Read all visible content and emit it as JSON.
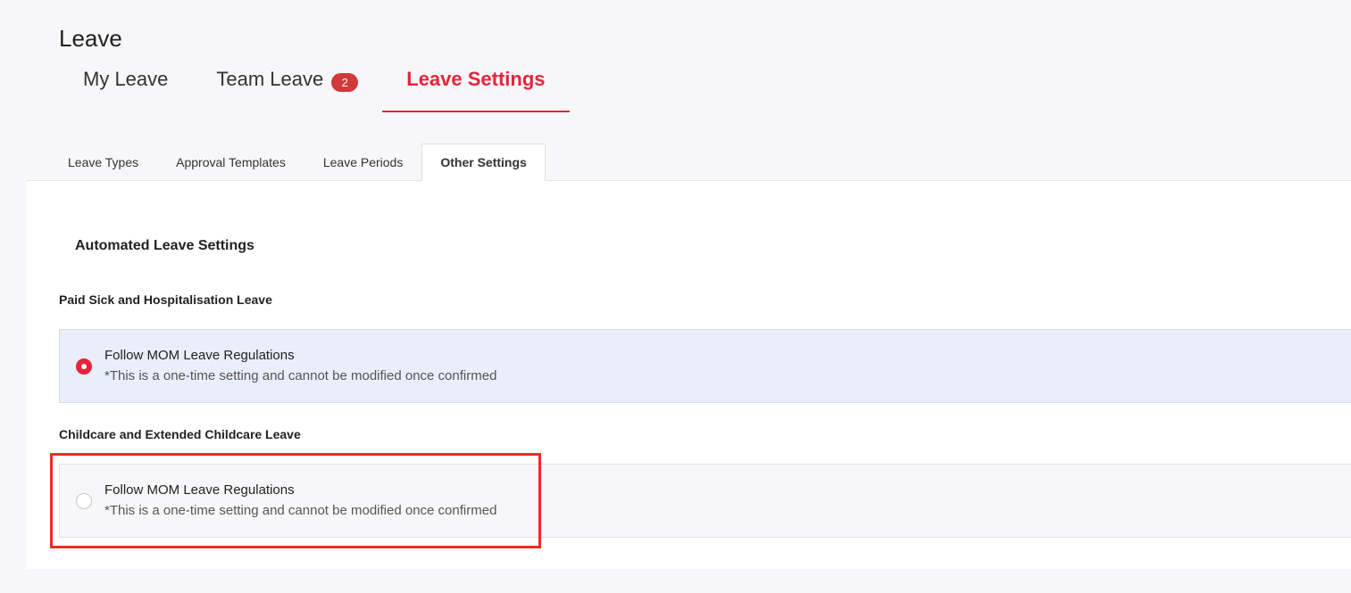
{
  "page": {
    "title": "Leave"
  },
  "main_tabs": [
    {
      "label": "My Leave"
    },
    {
      "label": "Team Leave",
      "badge": "2"
    },
    {
      "label": "Leave Settings"
    }
  ],
  "sub_tabs": [
    {
      "label": "Leave Types"
    },
    {
      "label": "Approval Templates"
    },
    {
      "label": "Leave Periods"
    },
    {
      "label": "Other Settings"
    }
  ],
  "content": {
    "section_title": "Automated Leave Settings",
    "groups": [
      {
        "label": "Paid Sick and Hospitalisation Leave",
        "option": {
          "title": "Follow MOM Leave Regulations",
          "subtitle": "*This is a one-time setting and cannot be modified once confirmed",
          "selected": true
        }
      },
      {
        "label": "Childcare and Extended Childcare Leave",
        "option": {
          "title": "Follow MOM Leave Regulations",
          "subtitle": "*This is a one-time setting and cannot be modified once confirmed",
          "selected": false
        }
      }
    ]
  },
  "colors": {
    "accent": "#e8233a",
    "badge": "#d03a3a",
    "selected_bg": "#e9eefb",
    "highlight": "#ee2b24"
  }
}
